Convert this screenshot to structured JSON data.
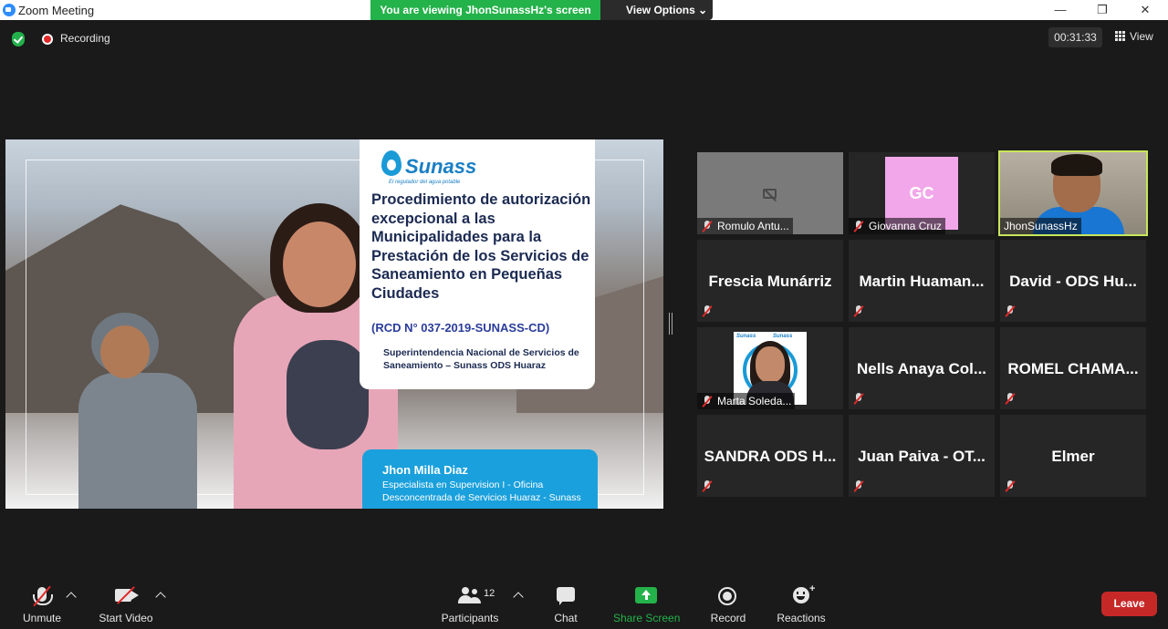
{
  "window": {
    "title": "Zoom Meeting",
    "minimize": "—",
    "restore": "❐",
    "close": "✕"
  },
  "banner": {
    "viewing": "You are viewing JhonSunassHz's screen",
    "view_options": "View Options ⌄"
  },
  "status": {
    "recording_label": "Recording",
    "timer": "00:31:33",
    "view_label": "View"
  },
  "slide": {
    "logo": "Sunass",
    "logo_tagline": "El regulador del agua potable",
    "title": "Procedimiento de autorización excepcional a las Municipalidades para la Prestación de los Servicios de Saneamiento en Pequeñas Ciudades",
    "reference": "(RCD N° 037-2019-SUNASS-CD)",
    "organization": "Superintendencia Nacional de Servicios de Saneamiento – Sunass ODS Huaraz",
    "presenter_name": "Jhon Milla Diaz",
    "presenter_role": "Especialista en Supervision I - Oficina Desconcentrada de Servicios Huaraz - Sunass"
  },
  "participants": [
    {
      "name": "Romulo Antu...",
      "display": "label",
      "muted": true,
      "media": "camera-off"
    },
    {
      "name": "Giovanna Cruz",
      "display": "label",
      "muted": true,
      "media": "avatar",
      "initials": "GC",
      "avatar_color": "#f2a7ea"
    },
    {
      "name": "JhonSunassHz",
      "display": "label",
      "muted": false,
      "media": "video",
      "active_speaker": true
    },
    {
      "name": "Frescia Munárriz",
      "display": "center",
      "muted": true
    },
    {
      "name": "Martin Huaman...",
      "display": "center",
      "muted": true
    },
    {
      "name": "David - ODS Hu...",
      "display": "center",
      "muted": true
    },
    {
      "name": "Marta Soleda...",
      "display": "label",
      "muted": true,
      "media": "photo",
      "photo_brand_left": "Sunass",
      "photo_brand_right": "Sunass"
    },
    {
      "name": "Nells Anaya Col...",
      "display": "center",
      "muted": true
    },
    {
      "name": "ROMEL CHAMA...",
      "display": "center",
      "muted": true
    },
    {
      "name": "SANDRA ODS H...",
      "display": "center",
      "muted": true
    },
    {
      "name": "Juan Paiva - OT...",
      "display": "center",
      "muted": true
    },
    {
      "name": "Elmer",
      "display": "center",
      "muted": true
    }
  ],
  "toolbar": {
    "unmute": "Unmute",
    "start_video": "Start Video",
    "participants": "Participants",
    "participants_count": "12",
    "chat": "Chat",
    "share_screen": "Share Screen",
    "record": "Record",
    "reactions": "Reactions",
    "leave": "Leave"
  },
  "colors": {
    "accent_green": "#24b24a",
    "leave_red": "#c62828",
    "active_speaker_border": "#c8e65a",
    "background": "#1a1a1a"
  }
}
